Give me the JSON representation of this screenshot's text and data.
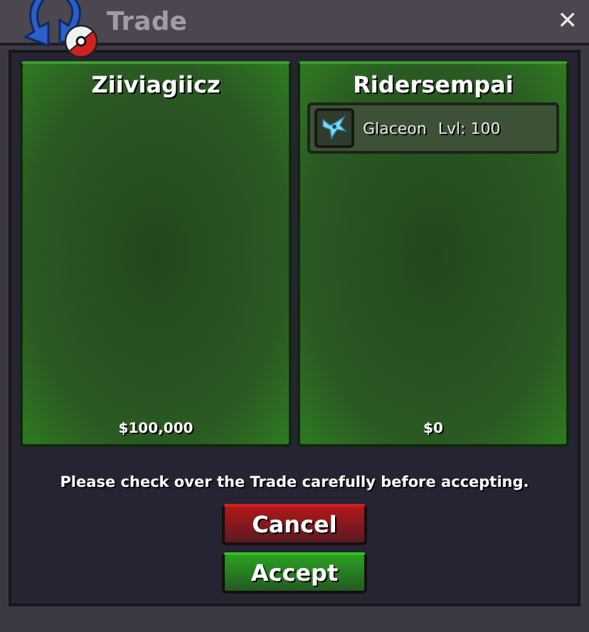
{
  "window": {
    "title": "Trade",
    "close": "✕"
  },
  "offers": [
    {
      "player": "Ziiviagiicz",
      "money": "$100,000"
    },
    {
      "player": "Ridersempai",
      "items": [
        {
          "name": "Glaceon",
          "level": "Lvl: 100"
        }
      ],
      "money": "$0"
    }
  ],
  "notice": "Please check over the Trade carefully before accepting.",
  "buttons": [
    {
      "label": "Cancel",
      "kind": "cancel"
    },
    {
      "label": "Accept",
      "kind": "accept"
    }
  ]
}
